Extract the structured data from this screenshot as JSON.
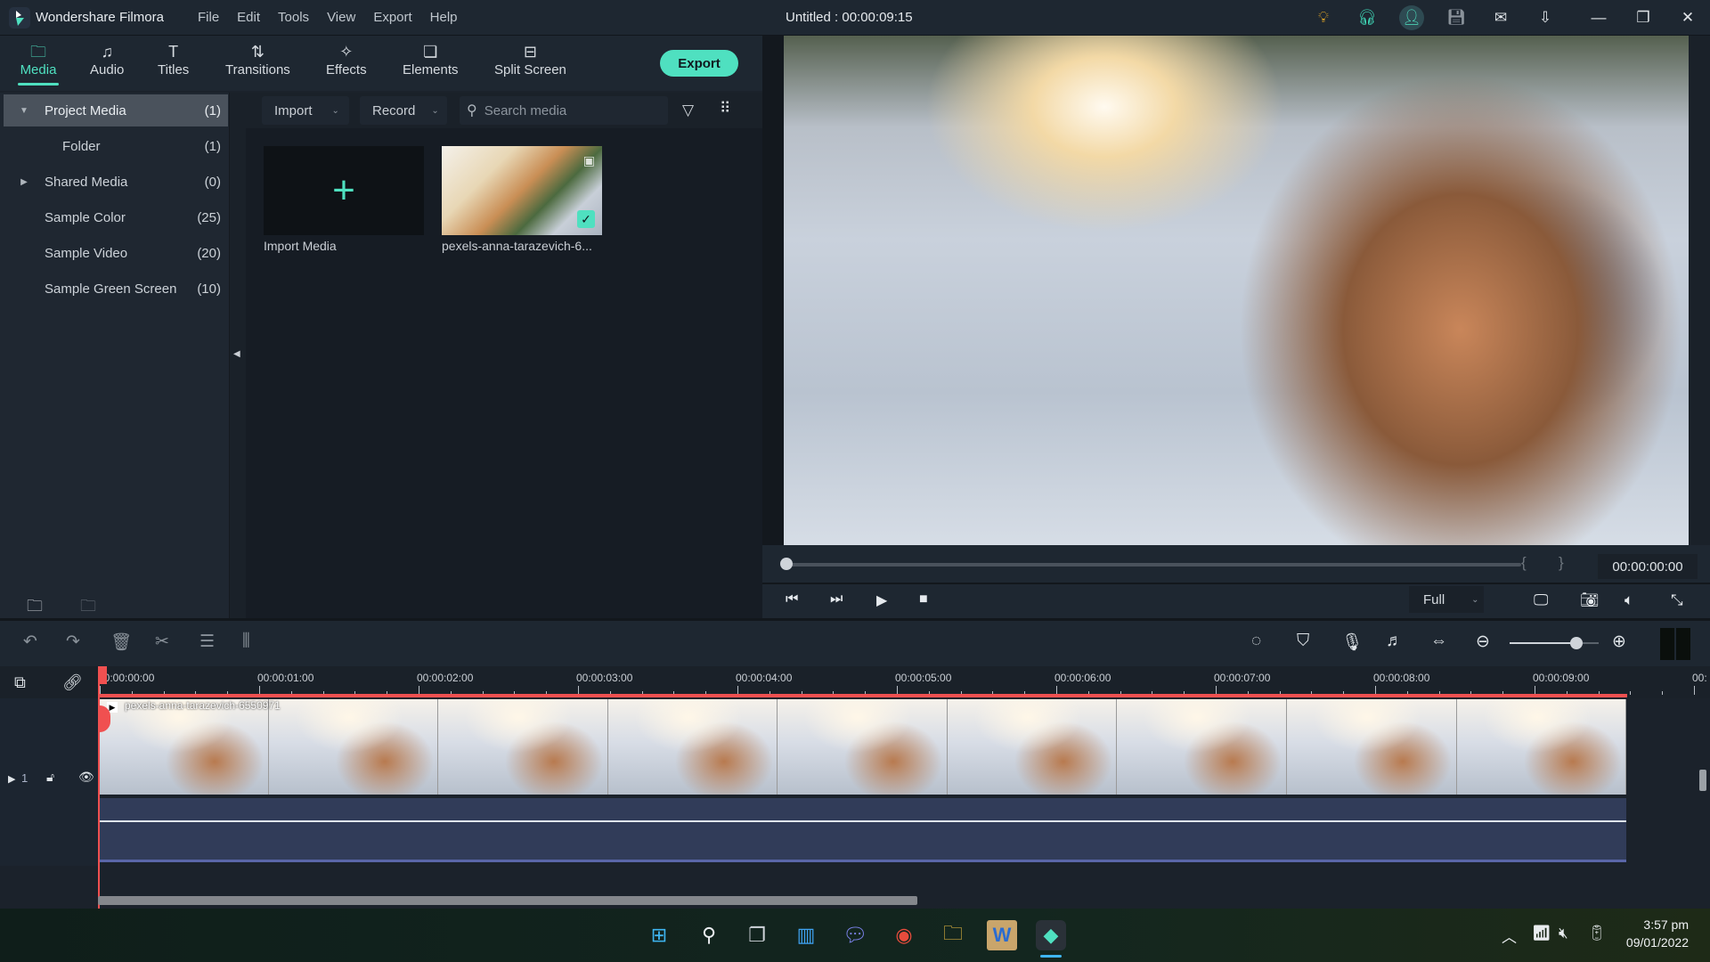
{
  "app": {
    "name": "Wondershare Filmora",
    "menu": [
      "File",
      "Edit",
      "Tools",
      "View",
      "Export",
      "Help"
    ],
    "document_title": "Untitled : 00:00:09:15",
    "title_icons": [
      "lightbulb-icon",
      "headset-icon",
      "account-icon",
      "save-icon",
      "mail-icon",
      "download-icon"
    ],
    "window_controls": {
      "minimize": "—",
      "restore": "❐",
      "close": "✕"
    }
  },
  "nav": {
    "tabs": [
      {
        "label": "Media",
        "icon": "🗀",
        "active": true
      },
      {
        "label": "Audio",
        "icon": "♫"
      },
      {
        "label": "Titles",
        "icon": "T"
      },
      {
        "label": "Transitions",
        "icon": "⇅"
      },
      {
        "label": "Effects",
        "icon": "✧"
      },
      {
        "label": "Elements",
        "icon": "❏"
      },
      {
        "label": "Split Screen",
        "icon": "⊟"
      }
    ],
    "export_label": "Export"
  },
  "library": {
    "items": [
      {
        "label": "Project Media",
        "count": "(1)",
        "arrow": "▼",
        "selected": true
      },
      {
        "label": "Folder",
        "count": "(1)",
        "indent": true
      },
      {
        "label": "Shared Media",
        "count": "(0)",
        "arrow": "▶"
      },
      {
        "label": "Sample Color",
        "count": "(25)"
      },
      {
        "label": "Sample Video",
        "count": "(20)"
      },
      {
        "label": "Sample Green Screen",
        "count": "(10)"
      }
    ]
  },
  "media": {
    "import_label": "Import",
    "record_label": "Record",
    "search_placeholder": "Search media",
    "tiles": [
      {
        "label": "Import Media"
      },
      {
        "label": "pexels-anna-tarazevich-6...",
        "selected": true
      }
    ]
  },
  "player": {
    "timecode": "00:00:00:00",
    "progress": 0,
    "mark_in": "{",
    "mark_out": "}",
    "quality": "Full"
  },
  "timeline": {
    "ruler_labels": [
      "00:00:00:00",
      "00:00:01:00",
      "00:00:02:00",
      "00:00:03:00",
      "00:00:04:00",
      "00:00:05:00",
      "00:00:06:00",
      "00:00:07:00",
      "00:00:08:00",
      "00:00:09:00",
      "00:"
    ],
    "zoom_level": 0.75,
    "track_number": "1",
    "clip_name": "pexels-anna-tarazevich-6550971",
    "frames": 9
  },
  "taskbar": {
    "apps": [
      "windows-start",
      "search",
      "task-view",
      "widgets",
      "teams-chat",
      "chrome",
      "file-explorer",
      "word",
      "filmora"
    ],
    "time": "3:57 pm",
    "date": "09/01/2022"
  }
}
